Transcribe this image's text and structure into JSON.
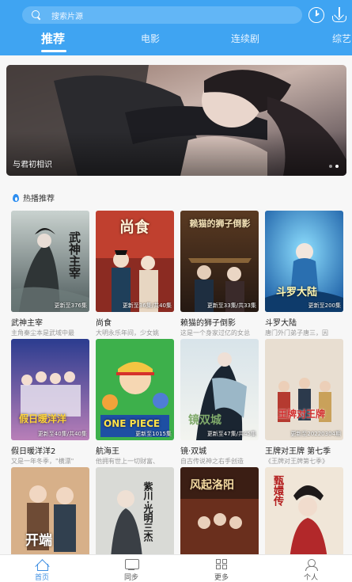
{
  "header": {
    "search_placeholder": "搜索片源",
    "tabs": [
      {
        "label": "推荐",
        "active": true
      },
      {
        "label": "电影",
        "active": false
      },
      {
        "label": "连续剧",
        "active": false
      },
      {
        "label": "综艺",
        "active": false
      }
    ]
  },
  "banner": {
    "caption": "与君初相识",
    "slide_count": 2,
    "active_slide": 2
  },
  "section": {
    "title": "热播推荐",
    "icon": "fire-icon"
  },
  "cards": [
    {
      "title": "武神主宰",
      "desc": "主角秦尘本是武域中最",
      "badge": "更新至376集",
      "poster_text": "武神主宰"
    },
    {
      "title": "尚食",
      "desc": "大明永乐年间，少女姚",
      "badge": "更新至36集/共40集",
      "poster_text": "尚食"
    },
    {
      "title": "赖猫的狮子倒影",
      "desc": "这是一个身家过亿的女总",
      "badge": "更新至33集/共33集",
      "poster_text": "赖猫的狮子倒影"
    },
    {
      "title": "斗罗大陆",
      "desc": "唐门外门弟子唐三，因",
      "badge": "更新至200集",
      "poster_text": "斗罗大陆"
    },
    {
      "title": "假日暖洋洋2",
      "desc": "又是一年冬季，\"横漂\"",
      "badge": "更新至40集/共40集",
      "poster_text": "假日暖洋洋"
    },
    {
      "title": "航海王",
      "desc": "他拥有世上一切财富、",
      "badge": "更新至1015集",
      "poster_text": "ONE PIECE"
    },
    {
      "title": "镜·双城",
      "desc": "自古传说神之右手创造",
      "badge": "更新至47集/共45集",
      "poster_text": "镜双城"
    },
    {
      "title": "王牌对王牌 第七季",
      "desc": "《王牌对王牌第七季》",
      "badge": "更新至20220304期",
      "poster_text": "王牌对王牌"
    },
    {
      "title": "",
      "desc": "",
      "badge": "",
      "poster_text": "开端"
    },
    {
      "title": "",
      "desc": "",
      "badge": "",
      "poster_text": "紫川·光明三杰"
    },
    {
      "title": "",
      "desc": "",
      "badge": "",
      "poster_text": "风起洛阳"
    },
    {
      "title": "",
      "desc": "",
      "badge": "",
      "poster_text": "甄嬛传"
    }
  ],
  "bottom_nav": [
    {
      "label": "首页",
      "icon": "home-icon",
      "active": true
    },
    {
      "label": "同步",
      "icon": "sync-icon",
      "active": false
    },
    {
      "label": "更多",
      "icon": "more-icon",
      "active": false
    },
    {
      "label": "个人",
      "icon": "user-icon",
      "active": false
    }
  ],
  "colors": {
    "header": "#3fa4f2",
    "accent": "#3f8fe2"
  }
}
